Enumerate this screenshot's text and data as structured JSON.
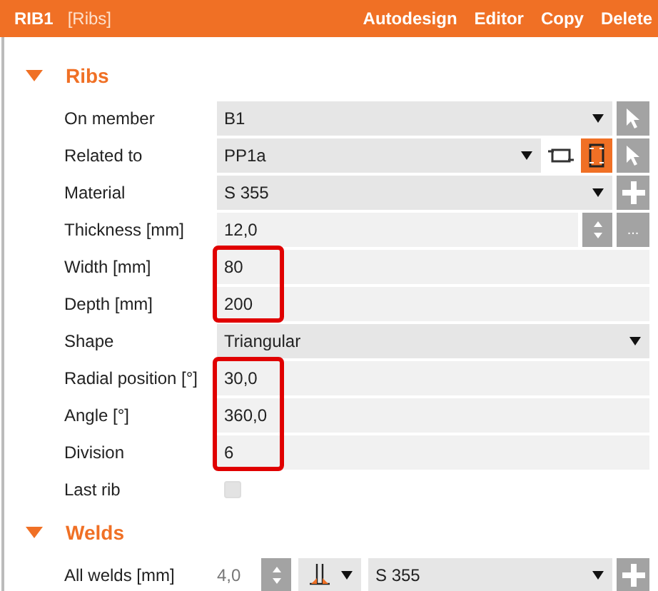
{
  "header": {
    "title": "RIB1",
    "subtitle": "[Ribs]",
    "actions": [
      "Autodesign",
      "Editor",
      "Copy",
      "Delete"
    ]
  },
  "sections": [
    {
      "title": "Ribs",
      "expanded": true,
      "rows": [
        {
          "kind": "select",
          "label": "On member",
          "value": "B1",
          "buttons": [
            {
              "kind": "pick"
            }
          ]
        },
        {
          "kind": "select",
          "label": "Related to",
          "value": "PP1a",
          "tools": [
            {
              "kind": "swap",
              "selected": false
            },
            {
              "kind": "frame",
              "selected": true
            }
          ],
          "buttons": [
            {
              "kind": "pick"
            }
          ]
        },
        {
          "kind": "select",
          "label": "Material",
          "value": "S 355",
          "buttons": [
            {
              "kind": "add"
            }
          ]
        },
        {
          "kind": "text",
          "label": "Thickness [mm]",
          "value": "12,0",
          "buttons": [
            {
              "kind": "spinner"
            },
            {
              "kind": "more",
              "label": "..."
            }
          ]
        },
        {
          "kind": "text",
          "label": "Width [mm]",
          "value": "80",
          "highlighted": true
        },
        {
          "kind": "text",
          "label": "Depth [mm]",
          "value": "200",
          "highlighted": true
        },
        {
          "kind": "select",
          "label": "Shape",
          "value": "Triangular"
        },
        {
          "kind": "text",
          "label": "Radial position [°]",
          "value": "30,0",
          "highlighted": true
        },
        {
          "kind": "text",
          "label": "Angle [°]",
          "value": "360,0",
          "highlighted": true
        },
        {
          "kind": "text",
          "label": "Division",
          "value": "6",
          "highlighted": true
        },
        {
          "kind": "checkbox",
          "label": "Last rib",
          "checked": false
        }
      ]
    },
    {
      "title": "Welds",
      "expanded": true,
      "rows": [
        {
          "kind": "weld",
          "label": "All welds [mm]",
          "value": "4,0",
          "material": "S 355",
          "buttons": [
            {
              "kind": "add"
            }
          ]
        }
      ]
    }
  ]
}
